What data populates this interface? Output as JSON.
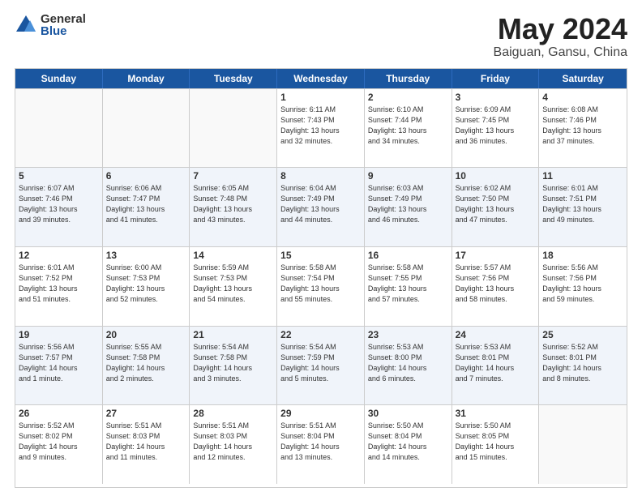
{
  "logo": {
    "general": "General",
    "blue": "Blue"
  },
  "title": "May 2024",
  "location": "Baiguan, Gansu, China",
  "weekdays": [
    "Sunday",
    "Monday",
    "Tuesday",
    "Wednesday",
    "Thursday",
    "Friday",
    "Saturday"
  ],
  "rows": [
    [
      {
        "day": "",
        "text": ""
      },
      {
        "day": "",
        "text": ""
      },
      {
        "day": "",
        "text": ""
      },
      {
        "day": "1",
        "text": "Sunrise: 6:11 AM\nSunset: 7:43 PM\nDaylight: 13 hours\nand 32 minutes."
      },
      {
        "day": "2",
        "text": "Sunrise: 6:10 AM\nSunset: 7:44 PM\nDaylight: 13 hours\nand 34 minutes."
      },
      {
        "day": "3",
        "text": "Sunrise: 6:09 AM\nSunset: 7:45 PM\nDaylight: 13 hours\nand 36 minutes."
      },
      {
        "day": "4",
        "text": "Sunrise: 6:08 AM\nSunset: 7:46 PM\nDaylight: 13 hours\nand 37 minutes."
      }
    ],
    [
      {
        "day": "5",
        "text": "Sunrise: 6:07 AM\nSunset: 7:46 PM\nDaylight: 13 hours\nand 39 minutes."
      },
      {
        "day": "6",
        "text": "Sunrise: 6:06 AM\nSunset: 7:47 PM\nDaylight: 13 hours\nand 41 minutes."
      },
      {
        "day": "7",
        "text": "Sunrise: 6:05 AM\nSunset: 7:48 PM\nDaylight: 13 hours\nand 43 minutes."
      },
      {
        "day": "8",
        "text": "Sunrise: 6:04 AM\nSunset: 7:49 PM\nDaylight: 13 hours\nand 44 minutes."
      },
      {
        "day": "9",
        "text": "Sunrise: 6:03 AM\nSunset: 7:49 PM\nDaylight: 13 hours\nand 46 minutes."
      },
      {
        "day": "10",
        "text": "Sunrise: 6:02 AM\nSunset: 7:50 PM\nDaylight: 13 hours\nand 47 minutes."
      },
      {
        "day": "11",
        "text": "Sunrise: 6:01 AM\nSunset: 7:51 PM\nDaylight: 13 hours\nand 49 minutes."
      }
    ],
    [
      {
        "day": "12",
        "text": "Sunrise: 6:01 AM\nSunset: 7:52 PM\nDaylight: 13 hours\nand 51 minutes."
      },
      {
        "day": "13",
        "text": "Sunrise: 6:00 AM\nSunset: 7:53 PM\nDaylight: 13 hours\nand 52 minutes."
      },
      {
        "day": "14",
        "text": "Sunrise: 5:59 AM\nSunset: 7:53 PM\nDaylight: 13 hours\nand 54 minutes."
      },
      {
        "day": "15",
        "text": "Sunrise: 5:58 AM\nSunset: 7:54 PM\nDaylight: 13 hours\nand 55 minutes."
      },
      {
        "day": "16",
        "text": "Sunrise: 5:58 AM\nSunset: 7:55 PM\nDaylight: 13 hours\nand 57 minutes."
      },
      {
        "day": "17",
        "text": "Sunrise: 5:57 AM\nSunset: 7:56 PM\nDaylight: 13 hours\nand 58 minutes."
      },
      {
        "day": "18",
        "text": "Sunrise: 5:56 AM\nSunset: 7:56 PM\nDaylight: 13 hours\nand 59 minutes."
      }
    ],
    [
      {
        "day": "19",
        "text": "Sunrise: 5:56 AM\nSunset: 7:57 PM\nDaylight: 14 hours\nand 1 minute."
      },
      {
        "day": "20",
        "text": "Sunrise: 5:55 AM\nSunset: 7:58 PM\nDaylight: 14 hours\nand 2 minutes."
      },
      {
        "day": "21",
        "text": "Sunrise: 5:54 AM\nSunset: 7:58 PM\nDaylight: 14 hours\nand 3 minutes."
      },
      {
        "day": "22",
        "text": "Sunrise: 5:54 AM\nSunset: 7:59 PM\nDaylight: 14 hours\nand 5 minutes."
      },
      {
        "day": "23",
        "text": "Sunrise: 5:53 AM\nSunset: 8:00 PM\nDaylight: 14 hours\nand 6 minutes."
      },
      {
        "day": "24",
        "text": "Sunrise: 5:53 AM\nSunset: 8:01 PM\nDaylight: 14 hours\nand 7 minutes."
      },
      {
        "day": "25",
        "text": "Sunrise: 5:52 AM\nSunset: 8:01 PM\nDaylight: 14 hours\nand 8 minutes."
      }
    ],
    [
      {
        "day": "26",
        "text": "Sunrise: 5:52 AM\nSunset: 8:02 PM\nDaylight: 14 hours\nand 9 minutes."
      },
      {
        "day": "27",
        "text": "Sunrise: 5:51 AM\nSunset: 8:03 PM\nDaylight: 14 hours\nand 11 minutes."
      },
      {
        "day": "28",
        "text": "Sunrise: 5:51 AM\nSunset: 8:03 PM\nDaylight: 14 hours\nand 12 minutes."
      },
      {
        "day": "29",
        "text": "Sunrise: 5:51 AM\nSunset: 8:04 PM\nDaylight: 14 hours\nand 13 minutes."
      },
      {
        "day": "30",
        "text": "Sunrise: 5:50 AM\nSunset: 8:04 PM\nDaylight: 14 hours\nand 14 minutes."
      },
      {
        "day": "31",
        "text": "Sunrise: 5:50 AM\nSunset: 8:05 PM\nDaylight: 14 hours\nand 15 minutes."
      },
      {
        "day": "",
        "text": ""
      }
    ]
  ]
}
